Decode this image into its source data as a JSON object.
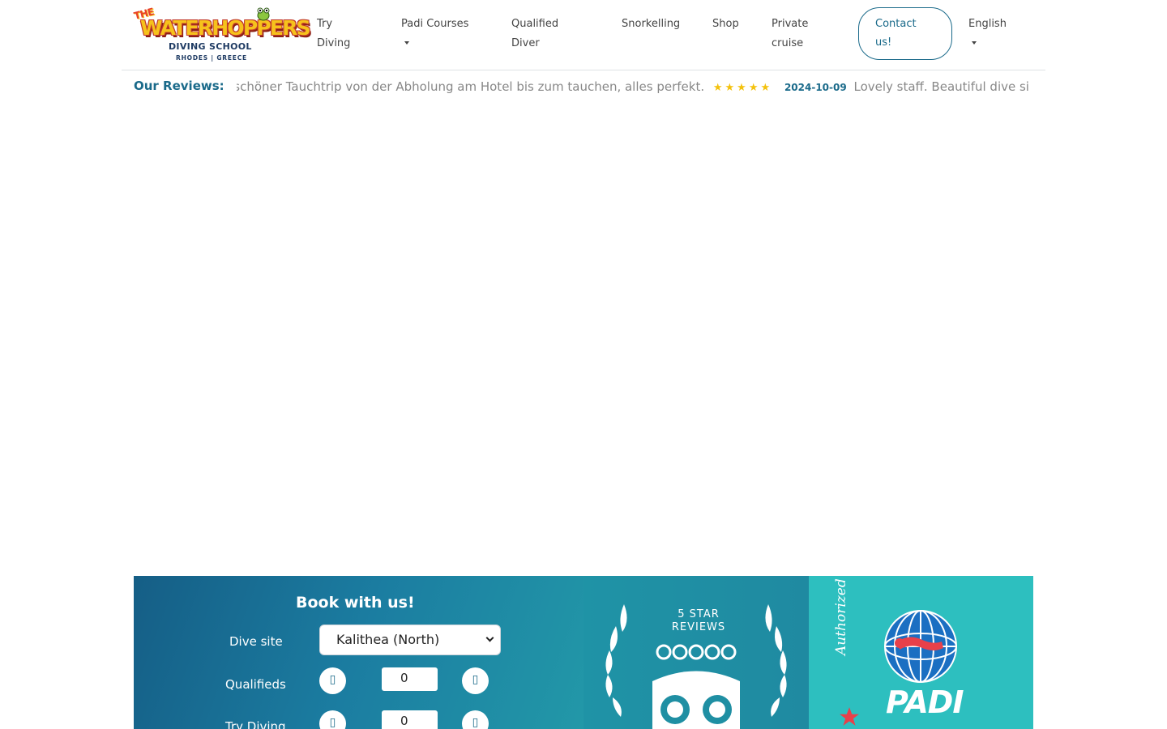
{
  "logo": {
    "the": "THE",
    "brand": "WATERHOPPERS",
    "subtitle": "DIVING SCHOOL",
    "location": "RHODES | GREECE"
  },
  "nav": {
    "items": [
      {
        "line1": "Try",
        "line2": "Diving"
      },
      {
        "line1": "Padi Courses",
        "line2": ""
      },
      {
        "line1": "Qualified",
        "line2": "Diver"
      },
      {
        "line1": "Snorkelling",
        "line2": ""
      },
      {
        "line1": "Shop",
        "line2": ""
      },
      {
        "line1": "Private",
        "line2": "cruise"
      }
    ],
    "contact": {
      "line1": "Contact",
      "line2": "us!"
    },
    "language": "English"
  },
  "reviews": {
    "title": "Our Reviews:",
    "entries": [
      {
        "date": "",
        "text": "n schöner Tauchtrip von der Abholung am Hotel bis zum tauchen, alles perfekt.",
        "stars": "★★★★★"
      },
      {
        "date": "2024-10-09",
        "text": "Lovely staff. Beautiful dive si",
        "stars": ""
      }
    ]
  },
  "booking": {
    "title": "Book with us!",
    "dive_site_label": "Dive site",
    "dive_site_value": "Kalithea (North)",
    "qualifieds_label": "Qualifieds",
    "qualifieds_value": "0",
    "try_diving_label": "Try Diving",
    "try_diving_value": "0",
    "minus_glyph": "▯",
    "plus_glyph": "▯"
  },
  "tripadvisor_badge": {
    "line1": "5 STAR",
    "line2": "REVIEWS",
    "icon": "owl-icon"
  },
  "padi_badge": {
    "authorized": "Authorized",
    "brand": "PADI",
    "icon": "padi-globe-diver-icon"
  },
  "colors": {
    "accent": "#1a6a8a",
    "star": "#f4c20d",
    "booking_bg": "#1b7da1",
    "padi_bg": "#2dbfbf",
    "logo_yellow": "#f6c21c",
    "logo_red": "#c0392b"
  }
}
